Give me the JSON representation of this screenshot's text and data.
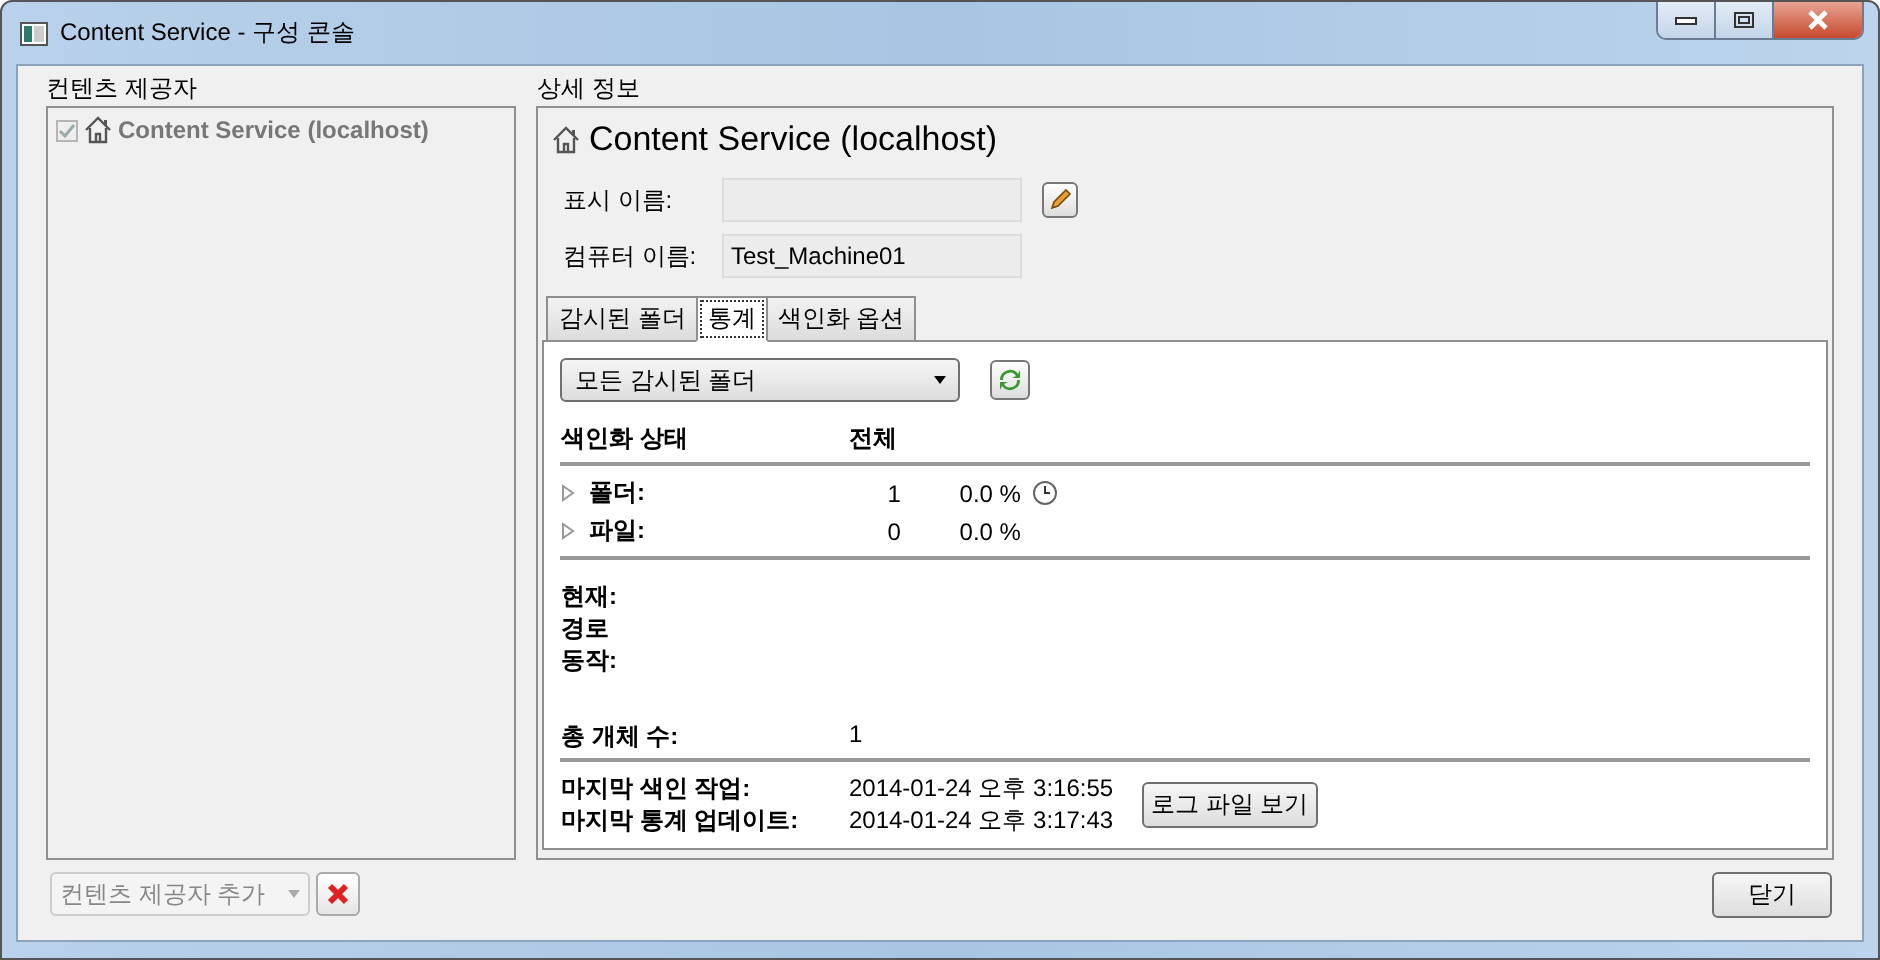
{
  "window": {
    "title": "Content Service - 구성 콘솔"
  },
  "providers": {
    "label": "컨텐츠 제공자",
    "items": [
      {
        "label": "Content Service (localhost)",
        "checked": true,
        "disabled": true
      }
    ],
    "add_dropdown": {
      "value": "컨텐츠 제공자 추가",
      "disabled": true
    }
  },
  "details": {
    "label": "상세 정보",
    "heading": "Content Service (localhost)",
    "fields": [
      {
        "label": "표시 이름:",
        "editable": true
      },
      {
        "label": "컴퓨터 이름:",
        "value": "Test_Machine01",
        "editable": false
      }
    ],
    "tabs": [
      {
        "label": "감시된 폴더",
        "selected": false
      },
      {
        "label": "통계",
        "selected": true
      },
      {
        "label": "색인화 옵션",
        "selected": false
      }
    ],
    "stats": {
      "folder_dropdown": {
        "value": "모든 감시된 폴더"
      },
      "columns": [
        "색인화 상태",
        "전체"
      ],
      "rows": [
        {
          "label": "폴더:",
          "total": "1",
          "percent": "0.0 %",
          "expanded": false,
          "clock": true
        },
        {
          "label": "파일:",
          "total": "0",
          "percent": "0.0 %",
          "expanded": false,
          "clock": false
        }
      ],
      "current_labels": [
        "현재:",
        "경로",
        "동작:"
      ],
      "total_objects": {
        "label": "총 개체 수:",
        "value": "1"
      },
      "last": [
        {
          "label": "마지막 색인 작업:",
          "value": "2014-01-24 오후 3:16:55"
        },
        {
          "label": "마지막 통계 업데이트:",
          "value": "2014-01-24 오후 3:17:43"
        }
      ],
      "log_button": "로그 파일 보기"
    }
  },
  "buttons": {
    "close": "닫기"
  }
}
